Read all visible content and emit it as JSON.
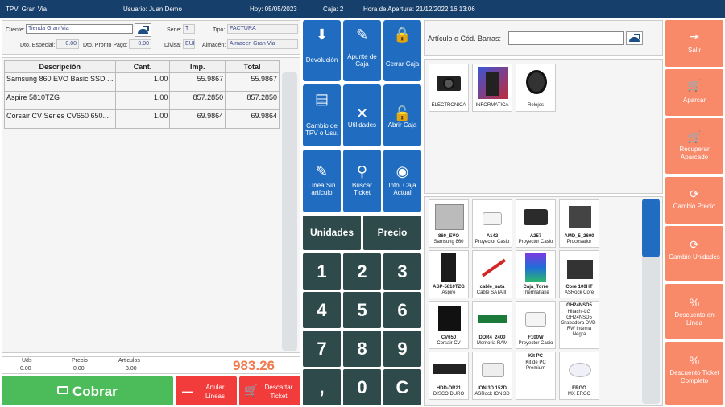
{
  "topbar": {
    "tpv": "TPV:  Gran Via",
    "usuario": "Usuario:  Juan Demo",
    "hoy": "Hoy:  05/05/2023",
    "caja": "Caja:  2",
    "apertura": "Hora de Apertura:  21/12/2022 16:13:06"
  },
  "header": {
    "cliente_label": "Cliente:",
    "cliente_value": "Tienda Gran Via",
    "serie_label": "Serie:",
    "serie_value": "T",
    "tipo_label": "Tipo:",
    "tipo_value": "FACTURA",
    "dto_especial_label": "Dto. Especial:",
    "dto_especial_value": "0.00",
    "dto_pronto_label": "Dto. Pronto Pago:",
    "dto_pronto_value": "0.00",
    "divisa_label": "Divisa:",
    "divisa_value": "EUR",
    "almacen_label": "Almacén:",
    "almacen_value": "Almacen Gran Via"
  },
  "lines": {
    "headers": [
      "Descripción",
      "Cant.",
      "Imp.",
      "Total"
    ],
    "rows": [
      [
        "Samsung 860 EVO Basic SSD ...",
        "1.00",
        "55.9867",
        "55.9867"
      ],
      [
        "Aspire 5810TZG",
        "1.00",
        "857.2850",
        "857.2850"
      ],
      [
        "Corsair CV Series CV650 650...",
        "1.00",
        "69.9864",
        "69.9864"
      ]
    ]
  },
  "totals": {
    "uds_label": "Uds",
    "uds_value": "0.00",
    "precio_label": "Precio",
    "precio_value": "0.00",
    "articulos_label": "Articulos",
    "articulos_value": "3.00",
    "total": "983.26"
  },
  "bottom": {
    "cobrar": "Cobrar",
    "anular": "Anular Líneas",
    "descartar": "Descartar Ticket"
  },
  "actions": [
    {
      "label": "Devolución",
      "icon": "return-icon"
    },
    {
      "label": "Apunte de Caja",
      "icon": "note-add-icon"
    },
    {
      "label": "Cerrar Caja",
      "icon": "lock-icon"
    },
    {
      "label": "Cambio de TPV o Usu.",
      "icon": "register-icon"
    },
    {
      "label": "Utilidades",
      "icon": "tools-icon"
    },
    {
      "label": "Abrir Caja",
      "icon": "unlock-icon"
    },
    {
      "label": "Línea Sin artículo",
      "icon": "pencil-icon"
    },
    {
      "label": "Buscar Ticket",
      "icon": "search-icon"
    },
    {
      "label": "Info. Caja Actual",
      "icon": "eye-icon"
    }
  ],
  "keypad": {
    "unidades": "Unidades",
    "precio": "Precio",
    "keys": [
      "1",
      "2",
      "3",
      "4",
      "5",
      "6",
      "7",
      "8",
      "9",
      ",",
      "0",
      "C"
    ]
  },
  "search": {
    "label": "Artículo o Cód. Barras:",
    "value": ""
  },
  "categories": [
    "ELECTRONICA",
    "INFORMATICA",
    "Relojes"
  ],
  "products": [
    {
      "code": "860_EVO",
      "name": "Samsung 860"
    },
    {
      "code": "A142",
      "name": "Proyector Casio"
    },
    {
      "code": "A257",
      "name": "Proyector Casio"
    },
    {
      "code": "AMD_5_2600",
      "name": "Procesador"
    },
    {
      "code": "ASP-5810TZG",
      "name": "Aspire"
    },
    {
      "code": "cable_sata",
      "name": "Cable SATA III"
    },
    {
      "code": "Caja_Torre",
      "name": "Thermaltake"
    },
    {
      "code": "Core 100HT",
      "name": "ASRock Core"
    },
    {
      "code": "CV650",
      "name": "Corsair CV"
    },
    {
      "code": "DDR4_2400",
      "name": "Memoria RAM"
    },
    {
      "code": "F100W",
      "name": "Proyector Casio"
    },
    {
      "code": "GH24NSD5",
      "name": "Hitachi-LG GH24NSD5 Grabadora DVD-RW Interna Negra"
    },
    {
      "code": "HDD-DR21",
      "name": "DISCO DURO"
    },
    {
      "code": "ION 3D 152D",
      "name": "ASRock ION 3D"
    },
    {
      "code": "Kit PC",
      "name": "Kit de PC Premium"
    },
    {
      "code": "ERGO",
      "name": "MX ERGO"
    }
  ],
  "right": [
    {
      "label": "Salir",
      "icon": "exit-icon"
    },
    {
      "label": "Aparcar",
      "icon": "cart-add-icon"
    },
    {
      "label": "Recuperar Aparcado",
      "icon": "cart-restore-icon"
    },
    {
      "label": "Cambio Precio",
      "icon": "refresh-icon"
    },
    {
      "label": "Cambio Unidades",
      "icon": "refresh-icon"
    },
    {
      "label": "Descuento en Línea",
      "icon": "percent-icon"
    },
    {
      "label": "Descuento Ticket Completo",
      "icon": "percent-icon"
    }
  ],
  "colors": {
    "topbar": "#173f6b",
    "action": "#1f6cc0",
    "keypad": "#2f4a4b",
    "cobrar": "#4cbb5a",
    "danger": "#f23b3b",
    "right": "#f88a6a",
    "total": "#f07b4f"
  }
}
